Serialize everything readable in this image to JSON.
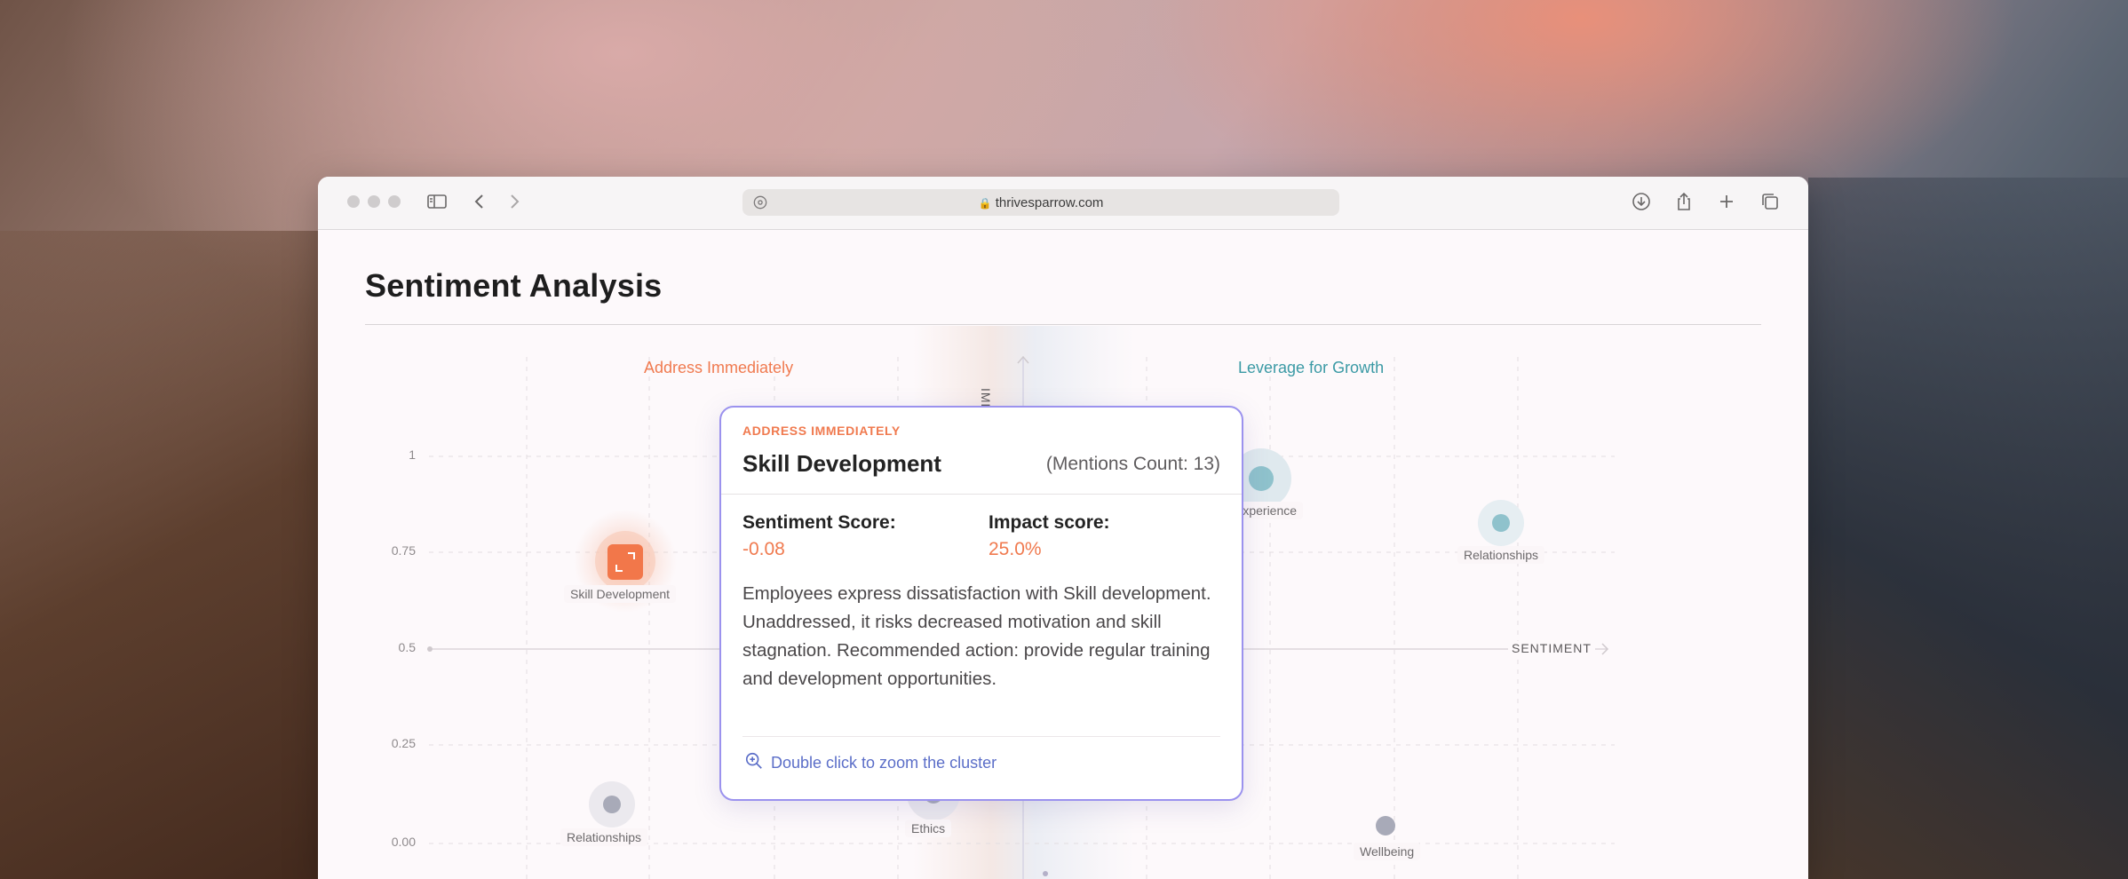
{
  "browser": {
    "url": "thrivesparrow.com",
    "icons": [
      "sidebar-icon",
      "back-icon",
      "forward-icon",
      "shield-icon",
      "lock-icon",
      "download-icon",
      "share-icon",
      "new-tab-icon",
      "tabs-overview-icon"
    ]
  },
  "page": {
    "title": "Sentiment Analysis"
  },
  "chart_data": {
    "type": "scatter",
    "quadrants": {
      "top_left": "Address Immediately",
      "top_right": "Leverage for Growth"
    },
    "y_ticks": [
      "1",
      "0.75",
      "0.5",
      "0.25",
      "0.00"
    ],
    "x_axis_label": "SENTIMENT",
    "y_axis_label": "IMPACT",
    "points": [
      {
        "label": "Skill Development",
        "quadrant": "Address Immediately",
        "highlighted": true
      },
      {
        "label": "Relationships",
        "quadrant": "lower-left"
      },
      {
        "label": "Ethics",
        "quadrant": "lower-left"
      },
      {
        "label": "Experience",
        "quadrant": "Leverage for Growth"
      },
      {
        "label": "Relationships",
        "quadrant": "Leverage for Growth"
      },
      {
        "label": "Wellbeing",
        "quadrant": "lower-right"
      }
    ],
    "colors": {
      "negative": "#f07a4f",
      "positive": "#3b9aa5",
      "neutral": "#a8aab8",
      "tooltip_border": "#9b92ee"
    }
  },
  "tooltip": {
    "kicker": "ADDRESS IMMEDIATELY",
    "title": "Skill Development",
    "count": "(Mentions Count: 13)",
    "sentiment_label": "Sentiment Score:",
    "sentiment_value": "-0.08",
    "impact_label": "Impact score:",
    "impact_value": "25.0%",
    "description": "Employees express dissatisfaction with Skill development. Unaddressed, it risks decreased motivation and skill stagnation. Recommended action: provide regular training and development opportunities.",
    "zoom_hint": "Double click to zoom the cluster"
  }
}
